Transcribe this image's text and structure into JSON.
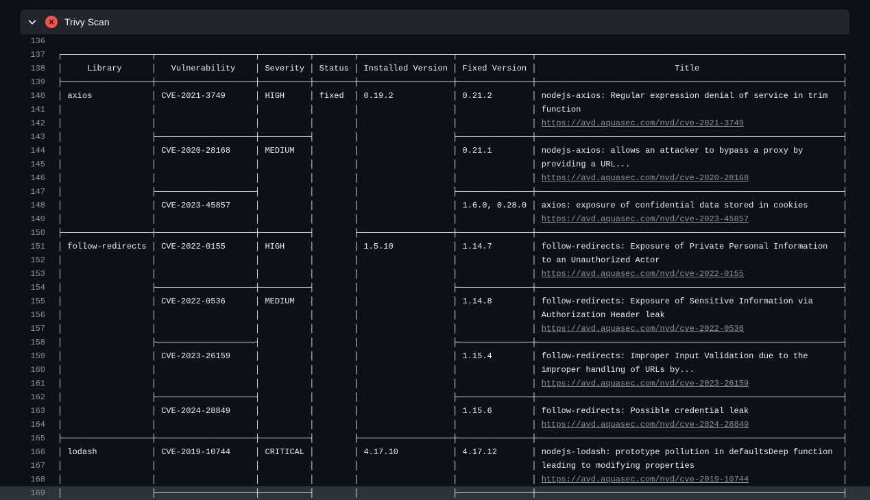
{
  "header": {
    "title": "Trivy Scan"
  },
  "startLine": 136,
  "columns": {
    "library": "Library",
    "vulnerability": "Vulnerability",
    "severity": "Severity",
    "status": "Status",
    "installed": "Installed Version",
    "fixed": "Fixed Version",
    "title": "Title"
  },
  "currentLine": 169,
  "lines": [
    {
      "n": 136,
      "c": ""
    },
    {
      "n": 137,
      "c": "┌──────────────────┬────────────────────┬──────────┬────────┬───────────────────┬───────────────┬──────────────────────────────────────────────────────────────┐"
    },
    {
      "n": 138,
      "c": "│     Library      │   Vulnerability    │ Severity │ Status │ Installed Version │ Fixed Version │                            Title                             │"
    },
    {
      "n": 139,
      "c": "├──────────────────┼────────────────────┼──────────┼────────┼───────────────────┼───────────────┼──────────────────────────────────────────────────────────────┤"
    },
    {
      "n": 140,
      "c": "│ axios            │ CVE-2021-3749      │ HIGH     │ fixed  │ 0.19.2            │ 0.21.2        │ nodejs-axios: Regular expression denial of service in trim   │"
    },
    {
      "n": 141,
      "c": "│                  │                    │          │        │                   │               │ function                                                     │"
    },
    {
      "n": 142,
      "c": "│                  │                    │          │        │                   │               │ ",
      "link": {
        "text": "https://avd.aquasec.com/nvd/cve-2021-3749",
        "href": "https://avd.aquasec.com/nvd/cve-2021-3749"
      },
      "rest": "                    │"
    },
    {
      "n": 143,
      "c": "│                  ├────────────────────┼──────────┤        │                   ├───────────────┼──────────────────────────────────────────────────────────────┤"
    },
    {
      "n": 144,
      "c": "│                  │ CVE-2020-28168     │ MEDIUM   │        │                   │ 0.21.1        │ nodejs-axios: allows an attacker to bypass a proxy by        │"
    },
    {
      "n": 145,
      "c": "│                  │                    │          │        │                   │               │ providing a URL...                                           │"
    },
    {
      "n": 146,
      "c": "│                  │                    │          │        │                   │               │ ",
      "link": {
        "text": "https://avd.aquasec.com/nvd/cve-2020-28168",
        "href": "https://avd.aquasec.com/nvd/cve-2020-28168"
      },
      "rest": "                   │"
    },
    {
      "n": 147,
      "c": "│                  ├────────────────────┤          │        │                   ├───────────────┼──────────────────────────────────────────────────────────────┤"
    },
    {
      "n": 148,
      "c": "│                  │ CVE-2023-45857     │          │        │                   │ 1.6.0, 0.28.0 │ axios: exposure of confidential data stored in cookies       │"
    },
    {
      "n": 149,
      "c": "│                  │                    │          │        │                   │               │ ",
      "link": {
        "text": "https://avd.aquasec.com/nvd/cve-2023-45857",
        "href": "https://avd.aquasec.com/nvd/cve-2023-45857"
      },
      "rest": "                   │"
    },
    {
      "n": 150,
      "c": "├──────────────────┼────────────────────┼──────────┤        ├───────────────────┼───────────────┼──────────────────────────────────────────────────────────────┤"
    },
    {
      "n": 151,
      "c": "│ follow-redirects │ CVE-2022-0155      │ HIGH     │        │ 1.5.10            │ 1.14.7        │ follow-redirects: Exposure of Private Personal Information   │"
    },
    {
      "n": 152,
      "c": "│                  │                    │          │        │                   │               │ to an Unauthorized Actor                                     │"
    },
    {
      "n": 153,
      "c": "│                  │                    │          │        │                   │               │ ",
      "link": {
        "text": "https://avd.aquasec.com/nvd/cve-2022-0155",
        "href": "https://avd.aquasec.com/nvd/cve-2022-0155"
      },
      "rest": "                    │"
    },
    {
      "n": 154,
      "c": "│                  ├────────────────────┼──────────┤        │                   ├───────────────┼──────────────────────────────────────────────────────────────┤"
    },
    {
      "n": 155,
      "c": "│                  │ CVE-2022-0536      │ MEDIUM   │        │                   │ 1.14.8        │ follow-redirects: Exposure of Sensitive Information via      │"
    },
    {
      "n": 156,
      "c": "│                  │                    │          │        │                   │               │ Authorization Header leak                                    │"
    },
    {
      "n": 157,
      "c": "│                  │                    │          │        │                   │               │ ",
      "link": {
        "text": "https://avd.aquasec.com/nvd/cve-2022-0536",
        "href": "https://avd.aquasec.com/nvd/cve-2022-0536"
      },
      "rest": "                    │"
    },
    {
      "n": 158,
      "c": "│                  ├────────────────────┤          │        │                   ├───────────────┼──────────────────────────────────────────────────────────────┤"
    },
    {
      "n": 159,
      "c": "│                  │ CVE-2023-26159     │          │        │                   │ 1.15.4        │ follow-redirects: Improper Input Validation due to the       │"
    },
    {
      "n": 160,
      "c": "│                  │                    │          │        │                   │               │ improper handling of URLs by...                              │"
    },
    {
      "n": 161,
      "c": "│                  │                    │          │        │                   │               │ ",
      "link": {
        "text": "https://avd.aquasec.com/nvd/cve-2023-26159",
        "href": "https://avd.aquasec.com/nvd/cve-2023-26159"
      },
      "rest": "                   │"
    },
    {
      "n": 162,
      "c": "│                  ├────────────────────┤          │        │                   ├───────────────┼──────────────────────────────────────────────────────────────┤"
    },
    {
      "n": 163,
      "c": "│                  │ CVE-2024-28849     │          │        │                   │ 1.15.6        │ follow-redirects: Possible credential leak                   │"
    },
    {
      "n": 164,
      "c": "│                  │                    │          │        │                   │               │ ",
      "link": {
        "text": "https://avd.aquasec.com/nvd/cve-2024-28849",
        "href": "https://avd.aquasec.com/nvd/cve-2024-28849"
      },
      "rest": "                   │"
    },
    {
      "n": 165,
      "c": "├──────────────────┼────────────────────┼──────────┤        ├───────────────────┼───────────────┼──────────────────────────────────────────────────────────────┤"
    },
    {
      "n": 166,
      "c": "│ lodash           │ CVE-2019-10744     │ CRITICAL │        │ 4.17.10           │ 4.17.12       │ nodejs-lodash: prototype pollution in defaultsDeep function  │"
    },
    {
      "n": 167,
      "c": "│                  │                    │          │        │                   │               │ leading to modifying properties                              │"
    },
    {
      "n": 168,
      "c": "│                  │                    │          │        │                   │               │ ",
      "link": {
        "text": "https://avd.aquasec.com/nvd/cve-2019-10744",
        "href": "https://avd.aquasec.com/nvd/cve-2019-10744"
      },
      "rest": "                   │"
    },
    {
      "n": 169,
      "c": "│                  ├────────────────────┼──────────┤        │                   ├───────────────┼──────────────────────────────────────────────────────────────┤"
    }
  ]
}
